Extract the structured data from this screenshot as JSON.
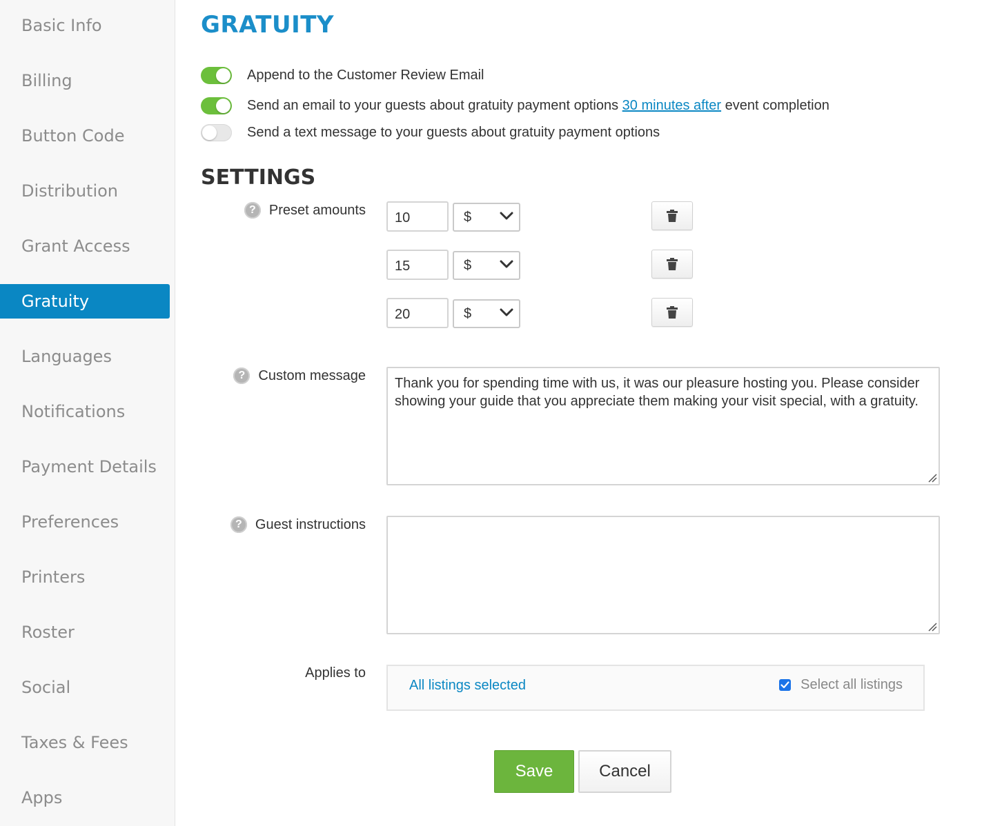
{
  "sidebar": {
    "items": [
      {
        "label": "Basic Info"
      },
      {
        "label": "Billing"
      },
      {
        "label": "Button Code"
      },
      {
        "label": "Distribution"
      },
      {
        "label": "Grant Access"
      },
      {
        "label": "Gratuity",
        "active": true
      },
      {
        "label": "Languages"
      },
      {
        "label": "Notifications"
      },
      {
        "label": "Payment Details"
      },
      {
        "label": "Preferences"
      },
      {
        "label": "Printers"
      },
      {
        "label": "Roster"
      },
      {
        "label": "Social"
      },
      {
        "label": "Taxes & Fees"
      },
      {
        "label": "Apps"
      }
    ]
  },
  "main": {
    "title": "GRATUITY",
    "toggles": [
      {
        "label": "Append to the Customer Review Email",
        "on": true
      },
      {
        "label_before": "Send an email to your guests about gratuity payment options ",
        "link": "30 minutes after",
        "label_after": " event completion",
        "on": true
      },
      {
        "label": "Send a text message to your guests about gratuity payment options",
        "on": false
      }
    ],
    "settings": {
      "title": "SETTINGS",
      "preset_label": "Preset amounts",
      "presets": [
        {
          "amount": "10",
          "currency": "$"
        },
        {
          "amount": "15",
          "currency": "$"
        },
        {
          "amount": "20",
          "currency": "$"
        }
      ],
      "custom_message_label": "Custom message",
      "custom_message": "Thank you for spending time with us, it was our pleasure hosting you. Please consider showing your guide that you appreciate them making your visit special, with a gratuity.",
      "guest_instructions_label": "Guest instructions",
      "guest_instructions": "",
      "applies_to_label": "Applies to",
      "listings_link": "All listings selected",
      "select_all_label": "Select all listings",
      "select_all_checked": true
    },
    "save_label": "Save",
    "cancel_label": "Cancel"
  },
  "colors": {
    "accent": "#0a87c3",
    "toggle_on": "#6cbf3c",
    "save_button": "#6cb53d"
  },
  "icons": {
    "help": "question-circle",
    "delete": "trash",
    "dropdown": "chevron-down"
  }
}
